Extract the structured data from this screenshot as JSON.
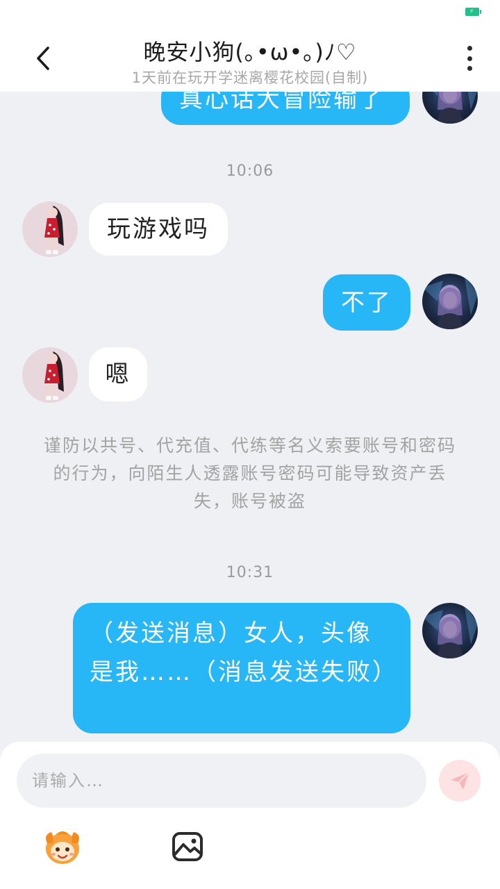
{
  "header": {
    "title": "晚安小狗(｡•ω•｡)ﾉ♡",
    "subtitle": "1天前在玩开学迷离樱花校园(自制)"
  },
  "messages": {
    "partial_top": "真心话大冒险输了",
    "time_1": "10:06",
    "msg_in_1": "玩游戏吗",
    "msg_out_1": "不了",
    "msg_in_2": "嗯",
    "notice": "谨防以共号、代充值、代练等名义索要账号和密码的行为，向陌生人透露账号密码可能导致资产丢失，账号被盗",
    "time_2": "10:31",
    "msg_out_2": "（发送消息）女人，头像是我……（消息发送失败）"
  },
  "input": {
    "placeholder": "请输入…",
    "value": ""
  },
  "colors": {
    "accent_blue": "#27b6f6",
    "background": "#eef0f4",
    "battery_green": "#22c08a",
    "send_disabled": "#fde3e3"
  },
  "icons": {
    "back": "chevron-left-icon",
    "more": "more-vertical-icon",
    "send": "send-icon",
    "emoji": "emoji-face-icon",
    "image": "image-icon"
  }
}
